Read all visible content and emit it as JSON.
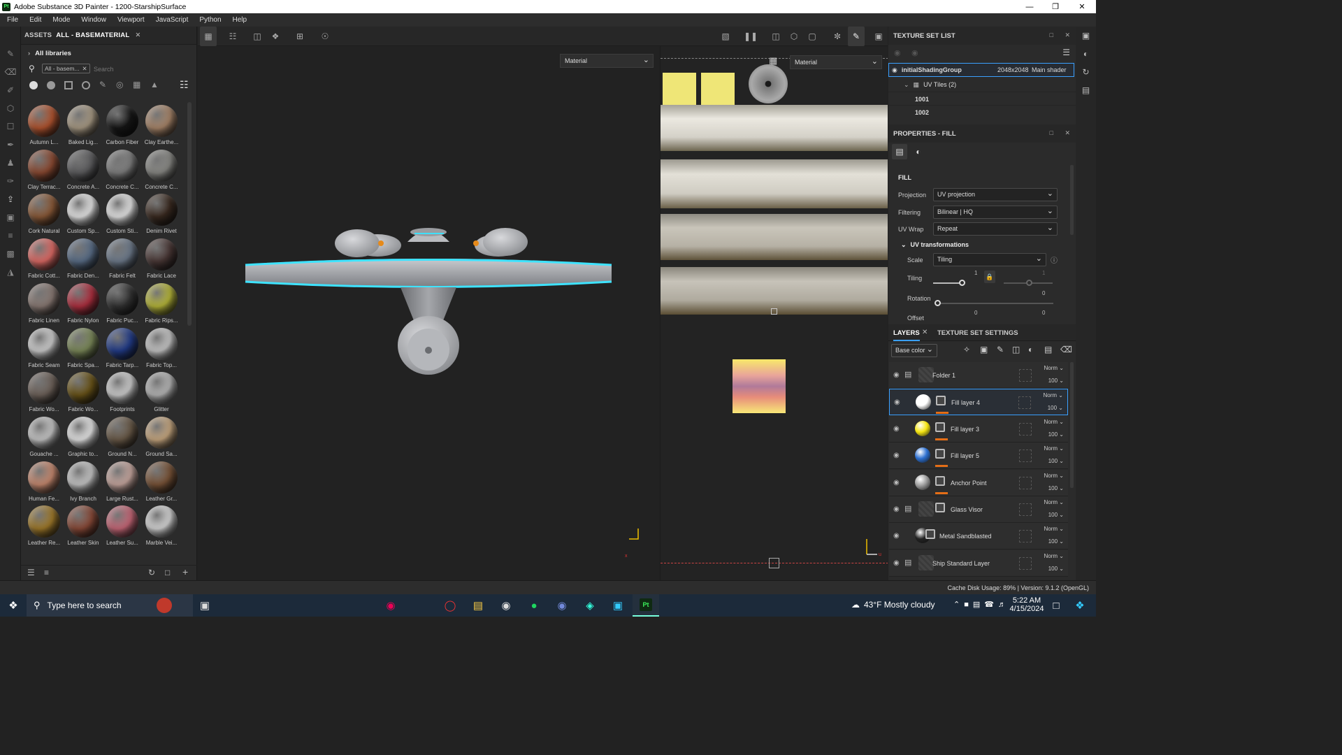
{
  "app": {
    "title": "Adobe Substance 3D Painter - 1200-StarshipSurface",
    "icon_text": "Pt"
  },
  "menu": [
    "File",
    "Edit",
    "Mode",
    "Window",
    "Viewport",
    "JavaScript",
    "Python",
    "Help"
  ],
  "assets": {
    "tab": "ASSETS",
    "breadcrumb": "ALL - BASEMATERIAL",
    "libraries": "All libraries",
    "filter_chip": "All - basem...",
    "search_placeholder": "Search",
    "materials": [
      {
        "label": "Autumn L...",
        "color": "#b2542f"
      },
      {
        "label": "Baked Lig...",
        "color": "#a89a84"
      },
      {
        "label": "Carbon Fiber",
        "color": "#161616"
      },
      {
        "label": "Clay Earthe...",
        "color": "#a9866a"
      },
      {
        "label": "Clay Terrac...",
        "color": "#8c4a32"
      },
      {
        "label": "Concrete A...",
        "color": "#5e5e60"
      },
      {
        "label": "Concrete C...",
        "color": "#808080"
      },
      {
        "label": "Concrete C...",
        "color": "#8a8a86"
      },
      {
        "label": "Cork Natural",
        "color": "#8b5a38"
      },
      {
        "label": "Custom Sp...",
        "color": "#e8e8e8"
      },
      {
        "label": "Custom Sti...",
        "color": "#e8e8e8"
      },
      {
        "label": "Denim Rivet",
        "color": "#3a2a20"
      },
      {
        "label": "Fabric Cott...",
        "color": "#e06b66"
      },
      {
        "label": "Fabric Den...",
        "color": "#5a6e88"
      },
      {
        "label": "Fabric Felt",
        "color": "#6e7b8c"
      },
      {
        "label": "Fabric Lace",
        "color": "#4a3836"
      },
      {
        "label": "Fabric Linen",
        "color": "#8a7a74"
      },
      {
        "label": "Fabric Nylon",
        "color": "#b03040"
      },
      {
        "label": "Fabric Puc...",
        "color": "#333"
      },
      {
        "label": "Fabric Rips...",
        "color": "#b8b83a"
      },
      {
        "label": "Fabric Seam",
        "color": "#d0d0d0"
      },
      {
        "label": "Fabric Spa...",
        "color": "#7c8a5a"
      },
      {
        "label": "Fabric Tarp...",
        "color": "#223c8a"
      },
      {
        "label": "Fabric Top...",
        "color": "#c8c8c8"
      },
      {
        "label": "Fabric Wo...",
        "color": "#6e625a"
      },
      {
        "label": "Fabric Wo...",
        "color": "#6a5418"
      },
      {
        "label": "Footprints",
        "color": "#d0d0d0"
      },
      {
        "label": "Glitter",
        "color": "#b8b8b8"
      },
      {
        "label": "Gouache ...",
        "color": "#c8c8c8"
      },
      {
        "label": "Graphic to...",
        "color": "#e8e8e8"
      },
      {
        "label": "Ground N...",
        "color": "#6a5a48"
      },
      {
        "label": "Ground Sa...",
        "color": "#c8a880"
      },
      {
        "label": "Human Fe...",
        "color": "#c88a70"
      },
      {
        "label": "Ivy Branch",
        "color": "#c8c8c8"
      },
      {
        "label": "Large Rust...",
        "color": "#c8a8a0"
      },
      {
        "label": "Leather Gr...",
        "color": "#7a5438"
      },
      {
        "label": "Leather Re...",
        "color": "#a07a2a"
      },
      {
        "label": "Leather Skin",
        "color": "#8a4a38"
      },
      {
        "label": "Leather Su...",
        "color": "#c86878"
      },
      {
        "label": "Marble Vei...",
        "color": "#d8d8d8"
      }
    ]
  },
  "viewport": {
    "left_mode": "Material",
    "right_mode": "Material"
  },
  "texture_set_list": {
    "title": "TEXTURE SET LIST",
    "set_name": "initialShadingGroup",
    "resolution": "2048x2048",
    "shader": "Main shader",
    "uv_tiles": "UV Tiles (2)",
    "tiles": [
      "1001",
      "1002"
    ]
  },
  "properties": {
    "title": "PROPERTIES - FILL",
    "section": "FILL",
    "projection_label": "Projection",
    "projection": "UV projection",
    "filtering_label": "Filtering",
    "filtering": "Bilinear | HQ",
    "uvwrap_label": "UV Wrap",
    "uvwrap": "Repeat",
    "uvtrans": "UV transformations",
    "scale_label": "Scale",
    "scale": "Tiling",
    "tiling_label": "Tiling",
    "tiling_a": "1",
    "tiling_b": "1",
    "rotation_label": "Rotation",
    "rotation_val": "0",
    "offset_label": "Offset",
    "offset_a": "0",
    "offset_b": "0"
  },
  "layers": {
    "tab": "LAYERS",
    "tab2": "TEXTURE SET SETTINGS",
    "channel": "Base color",
    "items": [
      {
        "name": "Folder 1",
        "blend": "Norm",
        "opacity": "100",
        "thumb": "#3a3a3a"
      },
      {
        "name": "Fill layer 4",
        "blend": "Norm",
        "opacity": "100",
        "thumb": "#ffffff"
      },
      {
        "name": "Fill layer 3",
        "blend": "Norm",
        "opacity": "100",
        "thumb": "#f5e512"
      },
      {
        "name": "Fill layer 5",
        "blend": "Norm",
        "opacity": "100",
        "thumb": "#2c6fd0"
      },
      {
        "name": "Anchor Point",
        "blend": "Norm",
        "opacity": "100",
        "thumb": "#9a9a9a"
      },
      {
        "name": "Glass Visor",
        "blend": "Norm",
        "opacity": "100",
        "thumb": "#3a3a3a"
      },
      {
        "name": "Metal Sandblasted",
        "blend": "Norm",
        "opacity": "100",
        "thumb": "#222"
      },
      {
        "name": "Ship Standard Layer",
        "blend": "Norm",
        "opacity": "100",
        "thumb": "#3a3a3a"
      }
    ]
  },
  "status": {
    "text": "Cache Disk Usage:  89% | Version: 9.1.2 (OpenGL)"
  },
  "taskbar": {
    "search": "Type here to search",
    "weather": "43°F  Mostly cloudy",
    "time": "5:22 AM",
    "date": "4/15/2024"
  }
}
